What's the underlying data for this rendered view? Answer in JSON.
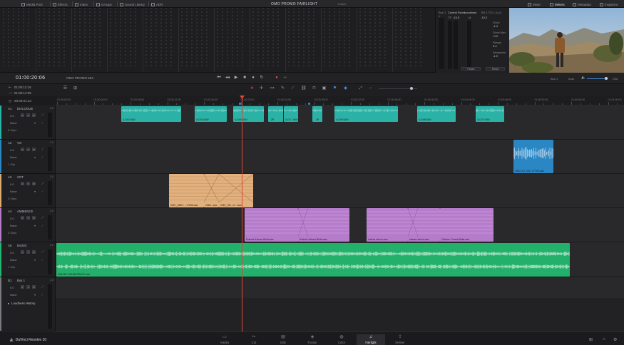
{
  "topbar": {
    "items": [
      "Media Pool",
      "Effects",
      "Index",
      "Groups",
      "Sound Library",
      "ADR"
    ],
    "project_title": "OMO PROMO FAIRLIGHT",
    "project_status": "Edited",
    "right_items": [
      "Mixer",
      "Meters",
      "Metadata",
      "Inspector"
    ]
  },
  "control_room": {
    "label": "Control Room",
    "bus": "Bus 1",
    "tp": "TP",
    "tp_val": "-13.5",
    "m_label": "M",
    "m_val": "-13.2",
    "loudness_label": "Loudness",
    "loudness_std": "BS.1770-1 (LU)",
    "short_label": "Short",
    "short_val": "-1.4",
    "short_max_label": "Short Max",
    "short_max_val": "-0.0",
    "range_label": "Range",
    "range_val": "3.4",
    "integrated_label": "Integrated",
    "integrated_val": "-1.9",
    "pause": "Pause",
    "reset": "Reset"
  },
  "transport": {
    "timecode": "01:00:20:06",
    "mix_name": "OMO PROMO MIX",
    "bus_label": "Bus 1",
    "auto_label": "Auto",
    "dim_label": "DIM"
  },
  "timecodes": [
    "01:00:12:16",
    "01:00:14:05",
    "00:00:01:13"
  ],
  "ruler": {
    "labels": [
      "01:00:00:00",
      "01:00:04:00",
      "01:00:08:00",
      "01:00:12:00",
      "01:00:16:00",
      "01:00:20:00",
      "01:00:24:00",
      "01:00:28:00",
      "01:00:32:00",
      "01:00:36:00",
      "01:00:40:00",
      "01:00:44:00",
      "01:00:48:00",
      "01:00:52:00",
      "01:00:56:00",
      "01:01:00:00"
    ]
  },
  "tracks": [
    {
      "code": "A1",
      "name": "DIALOGUE",
      "volume": "0.0",
      "input": "None",
      "clips": "8 Clips",
      "format": "2.0",
      "color": "#2bb2a6"
    },
    {
      "code": "A2",
      "name": "VO",
      "volume": "0.0",
      "input": "None",
      "clips": "1 Clip",
      "format": "1.0",
      "color": "#2b86c4"
    },
    {
      "code": "A3",
      "name": "SOT",
      "volume": "0.0",
      "input": "None",
      "clips": "3 Clips",
      "format": "2.0",
      "color": "#e0a96e"
    },
    {
      "code": "A4",
      "name": "AMBIENCE",
      "volume": "0.0",
      "input": "None",
      "clips": "5 Clips",
      "format": "2.0",
      "color": "#b47ac8"
    },
    {
      "code": "A5",
      "name": "MUSIC",
      "volume": "0.0",
      "input": "None",
      "clips": "1 Clip",
      "format": "2.0",
      "color": "#25b370"
    },
    {
      "code": "B1",
      "name": "Bus 1",
      "volume": "0.0",
      "input": "None",
      "clips": "",
      "format": "2.0",
      "color": "#7a7a80"
    }
  ],
  "loudness_history": "Loudness History",
  "clip_labels": {
    "dialogue": [
      "A-D02.WAV",
      "A-D03.WAV",
      "A-D05.WAV",
      "..2R",
      "A-D0...WAV",
      "...2R",
      "A-D05.WAV",
      "A-D08.WAV",
      "A-D07.WAV"
    ],
    "vo": "OMO VO_001_V7TH3.wav",
    "sot": [
      "0387_OBE1 ...17536.wav",
      "2666...wav",
      "0387_OB...17...wav"
    ],
    "ambience": [
      "Exterior Ahmos Wind.wav",
      "Exterior Ahmos Birds.wav",
      "Interior atmos.wav",
      "Interior atmos.wav",
      "Outdoor Crowd Walla.wav"
    ],
    "music": "OMI MIX SOUNDTRACK.wav"
  },
  "bottombar": {
    "brand": "DaVinci Resolve 20",
    "pages": [
      "Media",
      "Cut",
      "Edit",
      "Fusion",
      "Color",
      "Fairlight",
      "Deliver"
    ],
    "active_page": "Fairlight"
  },
  "colors": {
    "dialogue": "#2bb2a6",
    "vo": "#2b86c4",
    "sot": "#e0b07e",
    "ambience": "#b57ccc",
    "music": "#22b06a",
    "playhead": "#e0453a"
  }
}
